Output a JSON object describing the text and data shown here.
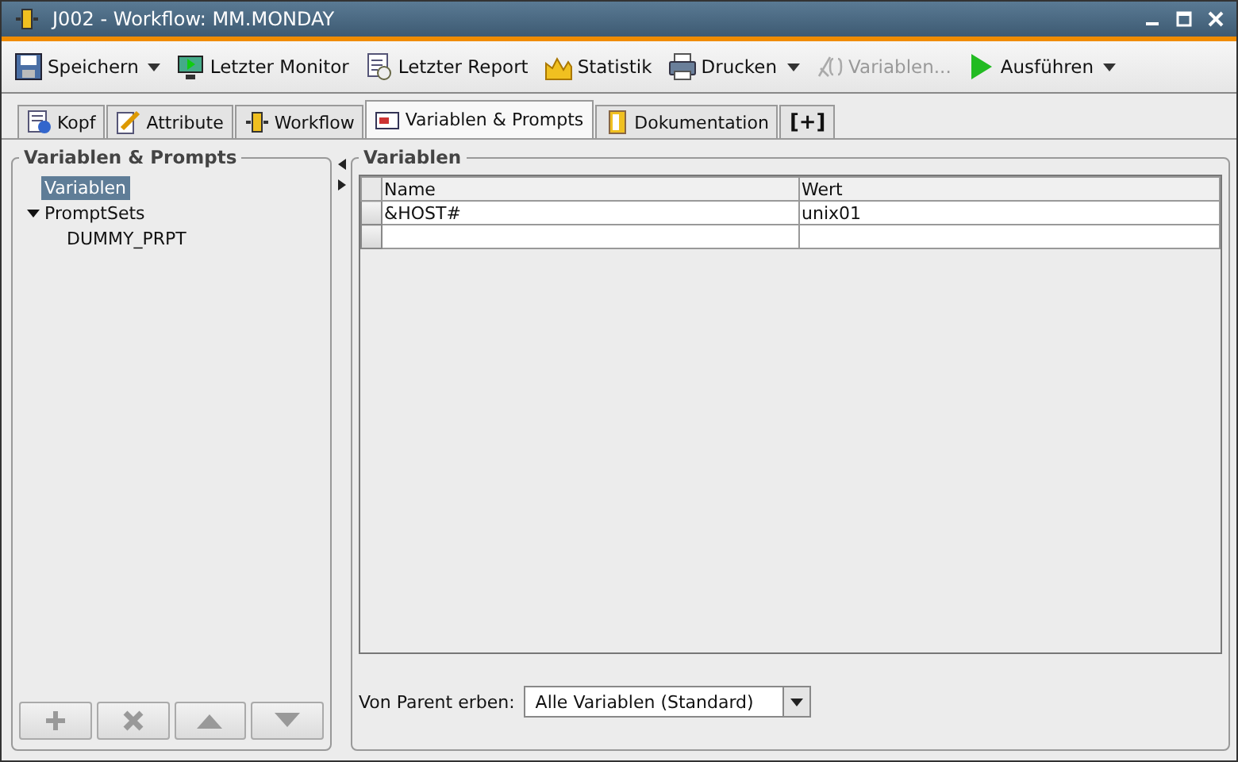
{
  "window": {
    "title": "J002 - Workflow: MM.MONDAY"
  },
  "toolbar": [
    {
      "label": "Speichern",
      "dropdown": true,
      "disabled": false
    },
    {
      "label": "Letzter Monitor",
      "dropdown": false,
      "disabled": false
    },
    {
      "label": "Letzter Report",
      "dropdown": false,
      "disabled": false
    },
    {
      "label": "Statistik",
      "dropdown": false,
      "disabled": false
    },
    {
      "label": "Drucken",
      "dropdown": true,
      "disabled": false
    },
    {
      "label": "Variablen...",
      "dropdown": false,
      "disabled": true
    },
    {
      "label": "Ausführen",
      "dropdown": true,
      "disabled": false
    }
  ],
  "tabs": [
    {
      "label": "Kopf",
      "selected": false
    },
    {
      "label": "Attribute",
      "selected": false
    },
    {
      "label": "Workflow",
      "selected": false
    },
    {
      "label": "Variablen & Prompts",
      "selected": true
    },
    {
      "label": "Dokumentation",
      "selected": false
    },
    {
      "label": "[+]",
      "selected": false
    }
  ],
  "sidebar": {
    "title": "Variablen & Prompts",
    "items": [
      {
        "label": "Variablen",
        "selected": true
      },
      {
        "label": "PromptSets",
        "selected": false,
        "expanded": true,
        "children": [
          {
            "label": "DUMMY_PRPT",
            "selected": false
          }
        ]
      }
    ]
  },
  "variables": {
    "title": "Variablen",
    "table": {
      "columns": [
        "Name",
        "Wert"
      ],
      "rows": [
        [
          "&HOST#",
          "unix01"
        ],
        [
          "",
          ""
        ]
      ]
    },
    "inherit": {
      "label": "Von Parent erben:",
      "value": "Alle Variablen (Standard)"
    }
  }
}
